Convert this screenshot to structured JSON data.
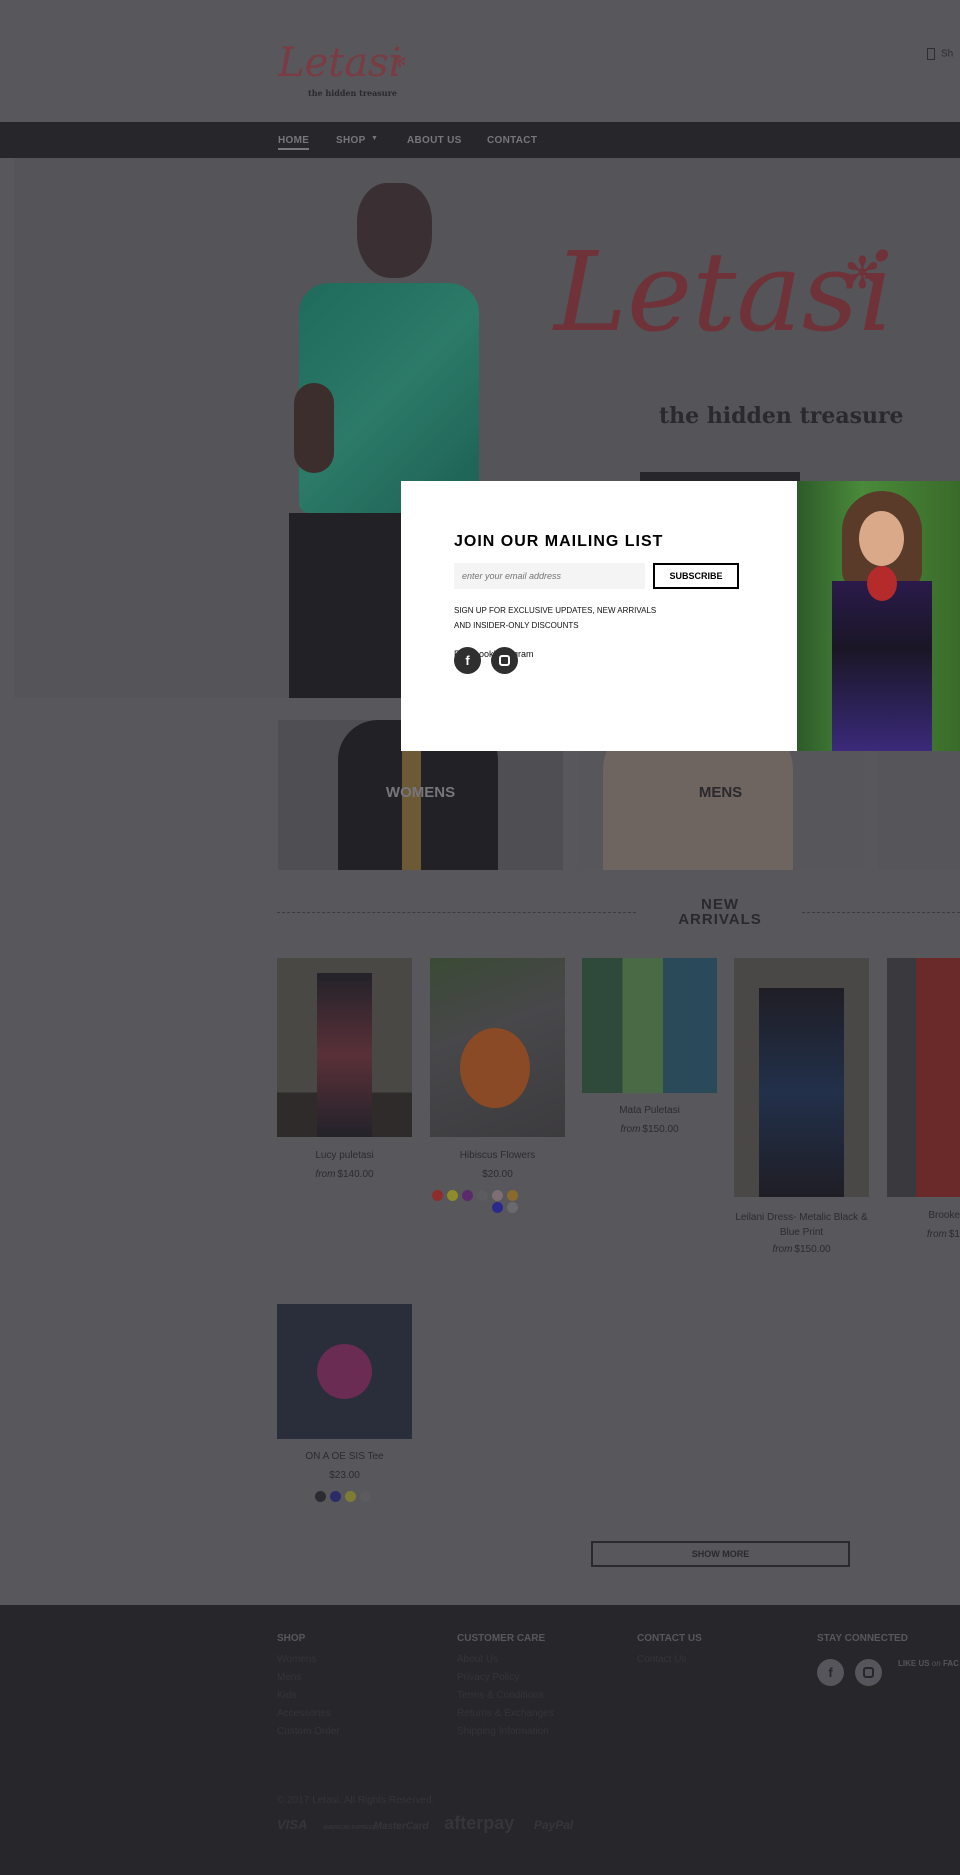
{
  "header": {
    "logo_text": "Letasi",
    "logo_tagline": "the hidden treasure",
    "cart_label": "Sh"
  },
  "nav": [
    {
      "label": "HOME"
    },
    {
      "label": "SHOP"
    },
    {
      "label": "ABOUT US"
    },
    {
      "label": "CONTACT"
    }
  ],
  "hero": {
    "logo_text": "Letasi",
    "logo_tagline": "the hidden treasure"
  },
  "categories": [
    {
      "label": "WOMENS"
    },
    {
      "label": "MENS"
    }
  ],
  "new_arrivals": {
    "title_line1": "NEW",
    "title_line2": "ARRIVALS"
  },
  "products": [
    {
      "name": "Lucy puletasi",
      "from": "from",
      "price": "$140.00"
    },
    {
      "name": "Hibiscus Flowers",
      "from": "",
      "price": "$20.00",
      "swatches": [
        "#8e2e2c",
        "#8e8b2a",
        "#5a2a6a",
        "#5c5b60",
        "#7e6e74",
        "#8a6a2c",
        "#2a2a8a",
        "#6a696e"
      ]
    },
    {
      "name": "Mata Puletasi",
      "from": "from",
      "price": "$150.00"
    },
    {
      "name": "Leilani Dress- Metalic Black & Blue Print",
      "from": "from",
      "price": "$150.00"
    },
    {
      "name": "Brooke",
      "from": "from",
      "price": "$1"
    },
    {
      "name": "ON A OE SIS Tee",
      "from": "",
      "price": "$23.00",
      "swatches": [
        "#2c2b33",
        "#2c2b6a",
        "#7e7c34",
        "#5c5b60"
      ]
    }
  ],
  "show_more": "SHOW MORE",
  "popup": {
    "title": "JOIN OUR MAILING LIST",
    "email_placeholder": "enter your email address",
    "subscribe": "SUBSCRIBE",
    "desc_line1": "SIGN UP FOR EXCLUSIVE UPDATES, NEW ARRIVALS",
    "desc_line2": "AND INSIDER-ONLY DISCOUNTS",
    "social_text": "FacebookInstagram"
  },
  "footer": {
    "shop": {
      "title": "SHOP",
      "links": [
        "Womens",
        "Mens",
        "Kids",
        "Accessories",
        "Custom Order"
      ]
    },
    "care": {
      "title": "CUSTOMER CARE",
      "links": [
        "About Us",
        "Privacy Policy",
        "Terms & Conditions",
        "Returns & Exchanges",
        "Shipping Information"
      ]
    },
    "contact": {
      "title": "CONTACT US",
      "links": [
        "Contact Us"
      ]
    },
    "connect": {
      "title": "STAY CONNECTED",
      "like": "LIKE US",
      "on": "on",
      "fb": "FAC"
    },
    "copyright": "© 2017 Letasi. All Rights Reserved.",
    "payments": [
      "VISA",
      "AMERICAN EXPRESS",
      "MasterCard",
      "afterpay",
      "PayPal"
    ]
  }
}
